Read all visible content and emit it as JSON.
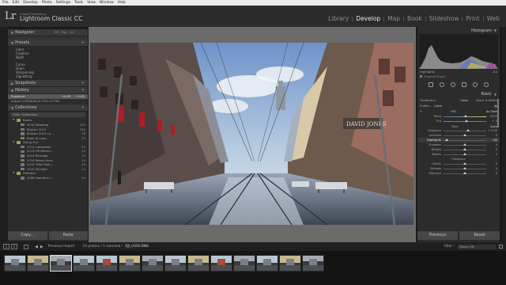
{
  "menu": [
    "File",
    "Edit",
    "Develop",
    "Photo",
    "Settings",
    "Tools",
    "View",
    "Window",
    "Help"
  ],
  "identity": {
    "logo": "Lr",
    "small": "Adobe Photoshop",
    "title": "Lightroom Classic CC"
  },
  "modules": [
    {
      "label": "Library",
      "active": false
    },
    {
      "label": "Develop",
      "active": true
    },
    {
      "label": "Map",
      "active": false
    },
    {
      "label": "Book",
      "active": false
    },
    {
      "label": "Slideshow",
      "active": false
    },
    {
      "label": "Print",
      "active": false
    },
    {
      "label": "Web",
      "active": false
    }
  ],
  "left": {
    "navigator": {
      "title": "Navigator",
      "fit": "FIT",
      "fill": "FILL",
      "z1": "1:1",
      "z2": "1:1"
    },
    "presets": {
      "title": "Presets",
      "items": [
        "Color",
        "Creative",
        "B&W",
        "Curve",
        "Grain",
        "Sharpening",
        "Vignetting"
      ]
    },
    "snapshots": {
      "title": "Snapshots"
    },
    "history": {
      "title": "History",
      "rows": [
        {
          "label": "Exposure",
          "v1": "+0.65",
          "v2": "+0.65",
          "selected": true
        },
        {
          "label": "Import (23/06/2019 9:51:13 PM)",
          "v1": "",
          "v2": "",
          "selected": false
        }
      ]
    },
    "collections": {
      "title": "Collections",
      "filter": "Filter Collections",
      "rows": [
        {
          "label": "Books",
          "count": "",
          "kind": "folder",
          "selected": false
        },
        {
          "label": "2016 Wedding",
          "count": "153",
          "kind": "item",
          "selected": false
        },
        {
          "label": "Bhutan 2012",
          "count": "290",
          "kind": "item",
          "selected": false
        },
        {
          "label": "Bhutan 2012 La...",
          "count": "78",
          "kind": "item",
          "selected": false
        },
        {
          "label": "Book of Love",
          "count": "53",
          "kind": "item",
          "selected": false
        },
        {
          "label": "Going Out",
          "count": "",
          "kind": "folder",
          "selected": false
        },
        {
          "label": "2012 Halloween",
          "count": "57",
          "kind": "item",
          "selected": false
        },
        {
          "label": "2013 Oil Glenrh...",
          "count": "12",
          "kind": "item",
          "selected": false
        },
        {
          "label": "2014 Bendigo",
          "count": "29",
          "kind": "item",
          "selected": false
        },
        {
          "label": "2014 Peony Farm",
          "count": "14",
          "kind": "item",
          "selected": false
        },
        {
          "label": "2014 Tulip Festi...",
          "count": "49",
          "kind": "item",
          "selected": false
        },
        {
          "label": "2015 Skyhigh",
          "count": "14",
          "kind": "item",
          "selected": false
        },
        {
          "label": "Holidays",
          "count": "",
          "kind": "folder",
          "selected": false
        },
        {
          "label": "2008 Hamilton I...",
          "count": "54",
          "kind": "item",
          "selected": false
        }
      ]
    },
    "copy": "Copy...",
    "paste": "Paste"
  },
  "right": {
    "histogram": {
      "title": "Histogram",
      "highlights": "Highlights",
      "hl_value": "-84",
      "original": "Original Photo"
    },
    "basic": {
      "title": "Basic",
      "treatment": "Treatment :",
      "color": "Color",
      "bw": "Black & White",
      "profile_label": "Profile :",
      "profile_value": "Color",
      "wb_label": "WB :",
      "wb_value": "As Shot",
      "temp": {
        "label": "Temp",
        "value": "5700",
        "pos": 0.52
      },
      "tint": {
        "label": "Tint",
        "value": "+ 3",
        "pos": 0.53
      },
      "tone": "Tone",
      "auto": "Auto",
      "exposure": {
        "label": "Exposure",
        "value": "+ 0.65",
        "pos": 0.58
      },
      "contrast": {
        "label": "Contrast",
        "value": "0",
        "pos": 0.5
      },
      "highlights": {
        "label": "Highlights",
        "value": "- 84",
        "pos": 0.08
      },
      "shadows": {
        "label": "Shadows",
        "value": "0",
        "pos": 0.5
      },
      "whites": {
        "label": "Whites",
        "value": "0",
        "pos": 0.5
      },
      "blacks": {
        "label": "Blacks",
        "value": "0",
        "pos": 0.5
      },
      "presence": "Presence",
      "clarity": {
        "label": "Clarity",
        "value": "0",
        "pos": 0.5
      },
      "dehaze": {
        "label": "Dehaze",
        "value": "0",
        "pos": 0.5
      },
      "vibrance": {
        "label": "Vibrance",
        "value": "0",
        "pos": 0.5
      }
    },
    "previous": "Previous",
    "reset": "Reset"
  },
  "filmbar": {
    "n1": "1",
    "n2": "2",
    "previous_import": "Previous Import",
    "info": "14 photos / 1 selected /",
    "filename": "DJI_0316.DNG",
    "filter_label": "Filter :",
    "filter_value": "Filters Off"
  },
  "colors": {
    "accent": "#e8e8e8",
    "panel": "#2c2c2c",
    "background": "#1a1a1a"
  }
}
